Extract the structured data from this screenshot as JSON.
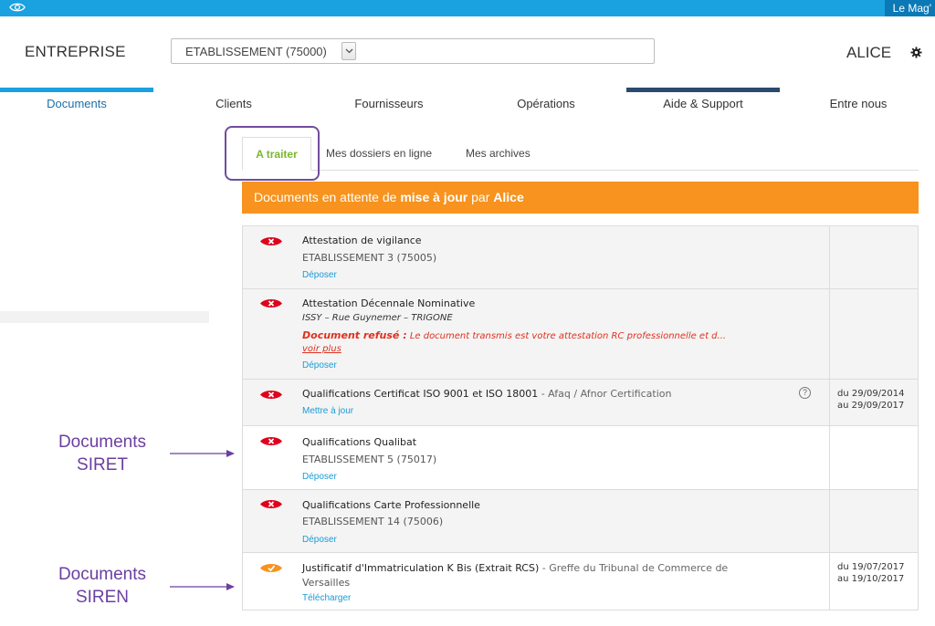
{
  "topbar": {
    "link": "Le Mag'",
    "icon": "eye-icon"
  },
  "header": {
    "company_label": "ENTREPRISE",
    "establishment_select": {
      "value": "ETABLISSEMENT (75000)"
    },
    "user": "ALICE",
    "settings_icon": "gear-icon"
  },
  "nav": {
    "items": [
      {
        "label": "Documents",
        "active": true
      },
      {
        "label": "Clients"
      },
      {
        "label": "Fournisseurs"
      },
      {
        "label": "Opérations"
      },
      {
        "label": "Aide & Support"
      },
      {
        "label": "Entre nous"
      }
    ]
  },
  "tabs": [
    {
      "label": "A traiter",
      "active": true
    },
    {
      "label": "Mes dossiers en ligne"
    },
    {
      "label": "Mes archives"
    }
  ],
  "banner": {
    "prefix": "Documents en attente de",
    "bold1": "mise à jour",
    "mid": "par",
    "bold2": "Alice"
  },
  "documents": [
    {
      "status": "refused",
      "title": "Attestation de vigilance",
      "subtitle": "ETABLISSEMENT 3 (75005)",
      "action": "Déposer"
    },
    {
      "status": "refused",
      "title": "Attestation Décennale Nominative",
      "subtitle": "ISSY – Rue Guynemer – TRIGONE",
      "refusal_label": "Document refusé :",
      "refusal_text": "Le document transmis est votre attestation RC professionnelle et d...",
      "more": "voir plus",
      "action": "Déposer"
    },
    {
      "status": "refused",
      "title": "Qualifications Certificat ISO 9001 et ISO 18001",
      "title_extra": "- Afaq / Afnor Certification",
      "help": "?",
      "action": "Mettre à jour",
      "date_from": "du 29/09/2014",
      "date_to": "au 29/09/2017"
    },
    {
      "status": "refused",
      "title": "Qualifications Qualibat",
      "subtitle": "ETABLISSEMENT 5 (75017)",
      "action": "Déposer"
    },
    {
      "status": "refused",
      "title": "Qualifications Carte Professionnelle",
      "subtitle": "ETABLISSEMENT 14 (75006)",
      "action": "Déposer"
    },
    {
      "status": "valid",
      "title": "Justificatif d'Immatriculation K Bis (Extrait RCS)",
      "title_extra": "- Greffe du Tribunal de Commerce de",
      "title_line2": "Versailles",
      "action": "Télécharger",
      "date_from": "du 19/07/2017",
      "date_to": "au 19/10/2017"
    }
  ],
  "annotations": [
    {
      "line1": "Documents",
      "line2": "SIRET"
    },
    {
      "line1": "Documents",
      "line2": "SIREN"
    }
  ],
  "colors": {
    "topbar": "#1aa1e0",
    "banner": "#f7931e",
    "refused": "#e0001b",
    "valid": "#f7931e",
    "annotation": "#6b3fa0",
    "active_tab": "#7ab72e"
  }
}
